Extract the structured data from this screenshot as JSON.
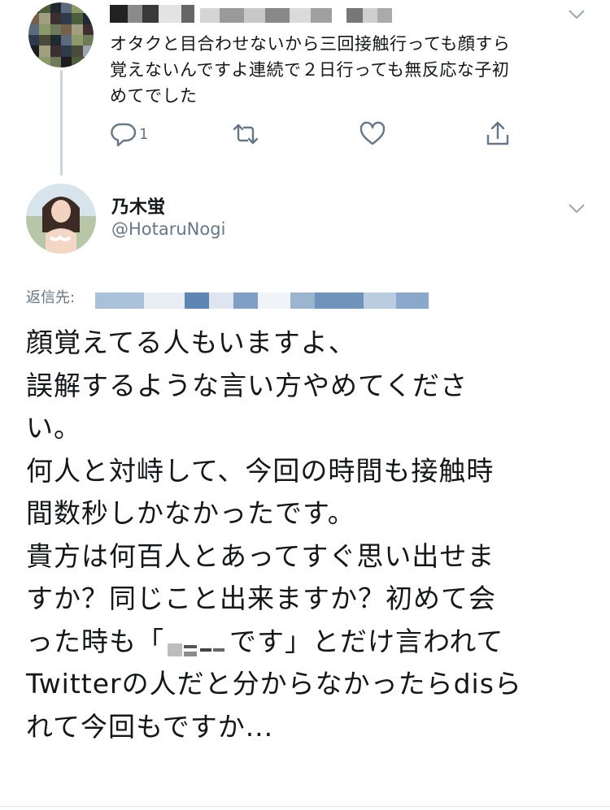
{
  "parent_tweet": {
    "text_lines": [
      "オタクと目合わせないから三回接触行っても顔すら",
      "覚えないんですよ連続で２日行っても無反応な子初",
      "めてでした"
    ],
    "actions": {
      "reply_count": "1"
    },
    "icons": {
      "reply": "reply-icon",
      "retweet": "retweet-icon",
      "like": "like-icon",
      "share": "share-icon",
      "menu": "chevron-down-icon"
    }
  },
  "reply_tweet": {
    "display_name": "乃木蛍",
    "handle": "@HotaruNogi",
    "reply_to_label": "返信先:",
    "text_lines": [
      "顔覚えてる人もいますよ、",
      "誤解するような言い方やめてくださ",
      "い。",
      "何人と対峙して、今回の時間も接触時",
      "間数秒しかなかったです。",
      "貴方は何百人とあってすぐ思い出せま",
      "すか？同じこと出来ますか？初めて会"
    ],
    "line8_before": "った時も「",
    "line8_after": "です」とだけ言われて",
    "text_lines_end": [
      "Twitterの人だと分からなかったらdisら",
      "れて今回もですか..."
    ]
  },
  "colors": {
    "text": "#14171a",
    "secondary": "#657786",
    "thread_line": "#ccd6dd"
  }
}
